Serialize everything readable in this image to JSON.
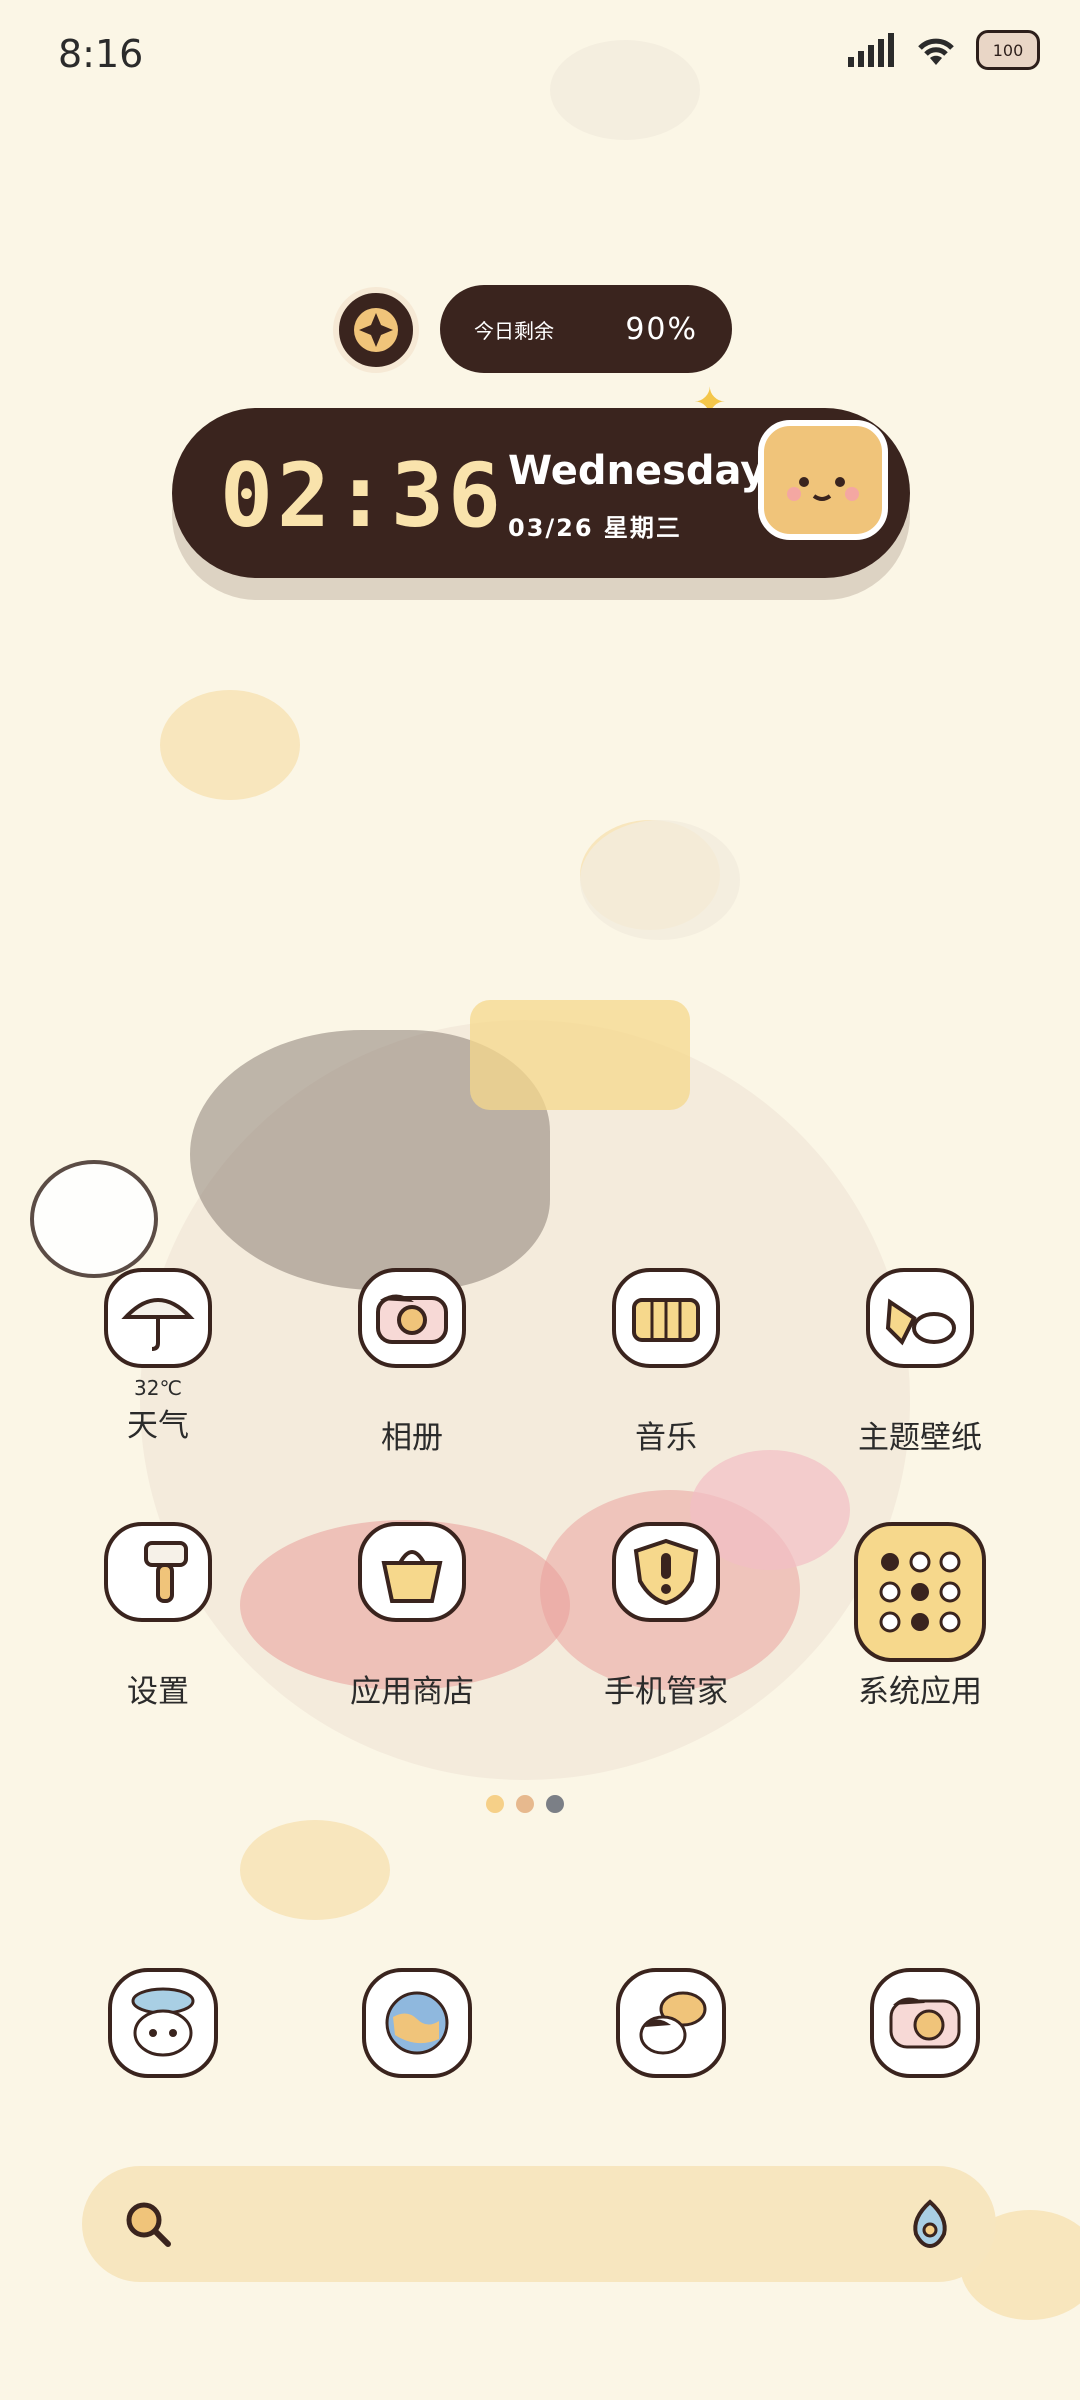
{
  "status_bar": {
    "time": "8:16",
    "battery": "100"
  },
  "widgets": {
    "remaining_label": "今日剩余",
    "remaining_value": "90%",
    "clock_time": "02:36",
    "clock_day": "Wednesday",
    "clock_date": "03/26  星期三"
  },
  "apps": [
    {
      "label": "天气",
      "sub": "32℃",
      "icon": "umbrella-icon"
    },
    {
      "label": "相册",
      "icon": "camera-icon"
    },
    {
      "label": "音乐",
      "icon": "accordion-icon"
    },
    {
      "label": "主题壁纸",
      "icon": "theme-icon"
    },
    {
      "label": "设置",
      "icon": "hammer-icon"
    },
    {
      "label": "应用商店",
      "icon": "bag-icon"
    },
    {
      "label": "手机管家",
      "icon": "shield-icon"
    },
    {
      "label": "系统应用",
      "icon": "folder-icon"
    }
  ],
  "dock": [
    {
      "icon": "phone-icon"
    },
    {
      "icon": "globe-icon"
    },
    {
      "icon": "message-icon"
    },
    {
      "icon": "camera-icon"
    }
  ],
  "colors": {
    "background": "#fbf6e6",
    "widget_dark": "#3a241e",
    "clock_digits": "#f9e3ac",
    "search_bar": "#f7e6bf"
  }
}
